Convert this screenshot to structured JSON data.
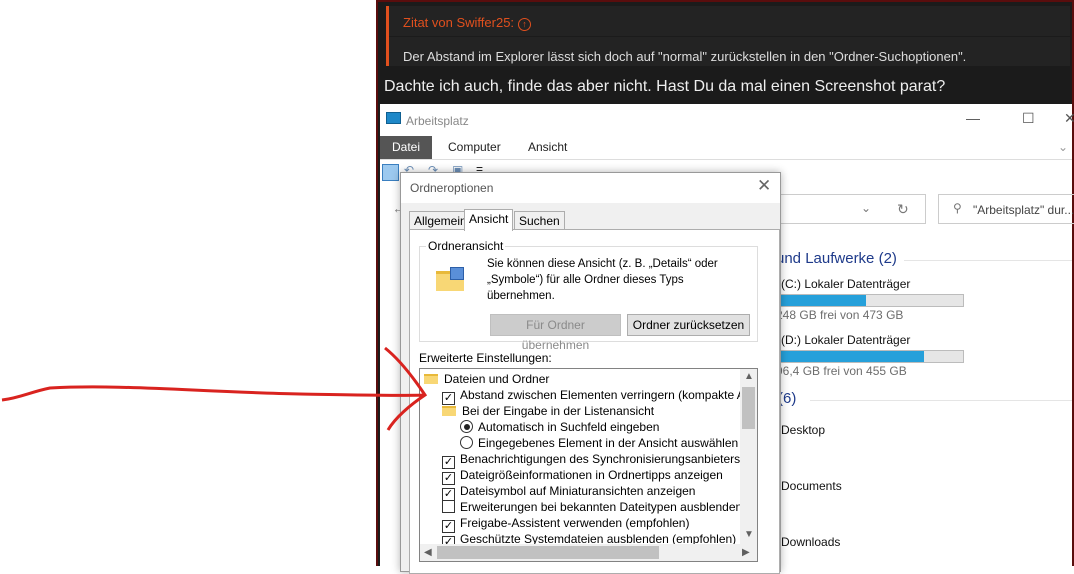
{
  "forum": {
    "quote_author": "Zitat von Swiffer25:",
    "quote_text": "Der Abstand im Explorer lässt sich doch auf \"normal\" zurückstellen in den \"Ordner-Suchoptionen\".",
    "reply_text": "Dachte ich auch, finde das aber nicht. Hast Du da mal einen Screenshot parat?",
    "accent_color": "#e0501e"
  },
  "explorer": {
    "title": "Arbeitsplatz",
    "ribbon_tabs": [
      "Datei",
      "Computer",
      "Ansicht"
    ],
    "search_placeholder": "\"Arbeitsplatz\" dur...",
    "drives_header": "und Laufwerke (2)",
    "drives": [
      {
        "label": "(C:) Lokaler Datenträger",
        "free": "248 GB frei von 473 GB",
        "used_fraction": 0.48
      },
      {
        "label": "(D:) Lokaler Datenträger",
        "free": "96,4 GB frei von 455 GB",
        "used_fraction": 0.79
      }
    ],
    "folders_header": "(6)",
    "folders": [
      "Desktop",
      "Documents",
      "Downloads"
    ]
  },
  "dialog": {
    "title": "Ordneroptionen",
    "tabs": [
      "Allgemein",
      "Ansicht",
      "Suchen"
    ],
    "group_label": "Ordneransicht",
    "group_text": "Sie können diese Ansicht (z. B. „Details“ oder „Symbole“) für alle Ordner dieses Typs übernehmen.",
    "apply_button": "Für Ordner übernehmen",
    "reset_button": "Ordner zurücksetzen",
    "advanced_label": "Erweiterte Einstellungen:",
    "settings": [
      {
        "type": "folder",
        "level": 0,
        "label": "Dateien und Ordner"
      },
      {
        "type": "checkbox",
        "level": 1,
        "checked": true,
        "label": "Abstand zwischen Elementen verringern (kompakte Ansicht)"
      },
      {
        "type": "folder",
        "level": 1,
        "label": "Bei der Eingabe in der Listenansicht"
      },
      {
        "type": "radio",
        "level": 2,
        "checked": true,
        "label": "Automatisch in Suchfeld eingeben"
      },
      {
        "type": "radio",
        "level": 2,
        "checked": false,
        "label": "Eingegebenes Element in der Ansicht auswählen"
      },
      {
        "type": "checkbox",
        "level": 1,
        "checked": true,
        "label": "Benachrichtigungen des Synchronisierungsanbieters anzeigen"
      },
      {
        "type": "checkbox",
        "level": 1,
        "checked": true,
        "label": "Dateigrößeinformationen in Ordnertipps anzeigen"
      },
      {
        "type": "checkbox",
        "level": 1,
        "checked": true,
        "label": "Dateisymbol auf Miniaturansichten anzeigen"
      },
      {
        "type": "checkbox",
        "level": 1,
        "checked": false,
        "label": "Erweiterungen bei bekannten Dateitypen ausblenden"
      },
      {
        "type": "checkbox",
        "level": 1,
        "checked": true,
        "label": "Freigabe-Assistent verwenden (empfohlen)"
      },
      {
        "type": "checkbox",
        "level": 1,
        "checked": true,
        "label": "Geschützte Systemdateien ausblenden (empfohlen)"
      }
    ]
  },
  "annotation_color": "#d9231f"
}
